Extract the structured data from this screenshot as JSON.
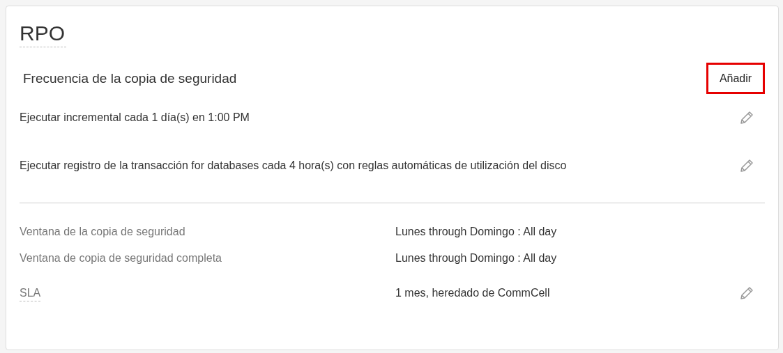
{
  "title": "RPO",
  "frequency": {
    "heading": "Frecuencia de la copia de seguridad",
    "add_button": {
      "label": "Añadir",
      "highlighted": true
    },
    "schedules": [
      {
        "text": "Ejecutar incremental cada 1 día(s) en 1:00 PM",
        "editable": true
      },
      {
        "text": "Ejecutar registro de la transacción for databases cada 4 hora(s) con reglas automáticas de utilización del disco",
        "editable": true
      }
    ]
  },
  "properties": [
    {
      "label": "Ventana de la copia de seguridad",
      "value": "Lunes through Domingo : All day",
      "has_tooltip": false,
      "editable": false
    },
    {
      "label": "Ventana de copia de seguridad completa",
      "value": "Lunes through Domingo : All day",
      "has_tooltip": false,
      "editable": false
    },
    {
      "label": "SLA",
      "value": "1 mes, heredado de CommCell",
      "has_tooltip": true,
      "editable": true
    }
  ]
}
